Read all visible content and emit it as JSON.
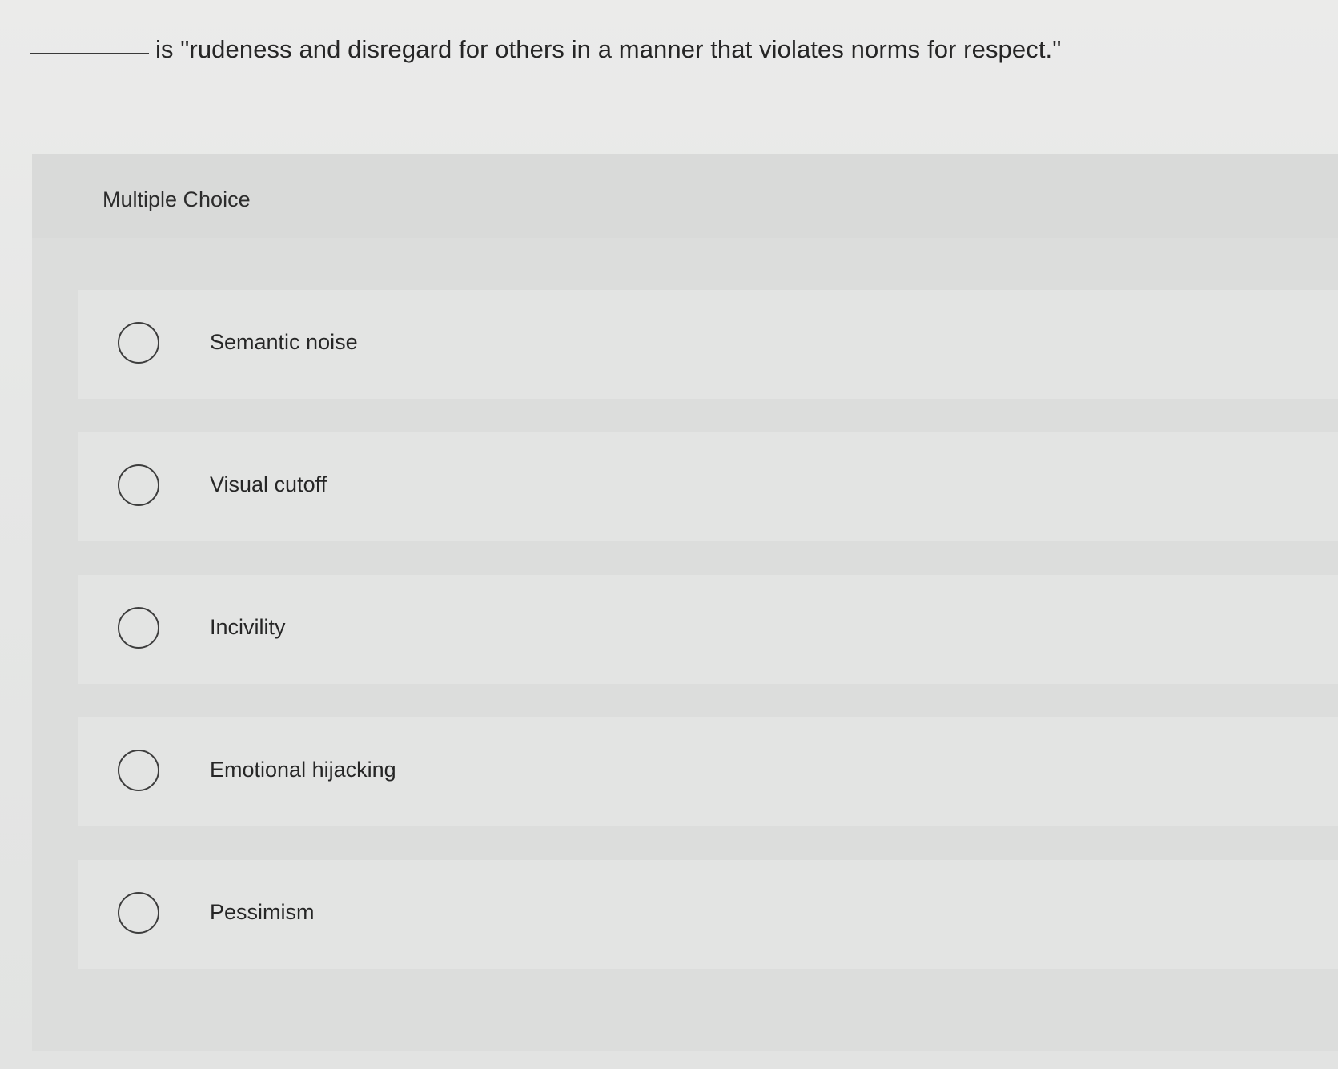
{
  "question": {
    "text": "is \"rudeness and disregard for others in a manner that violates norms for respect.\""
  },
  "section": {
    "label": "Multiple Choice"
  },
  "choices": [
    {
      "label": "Semantic noise"
    },
    {
      "label": "Visual cutoff"
    },
    {
      "label": "Incivility"
    },
    {
      "label": "Emotional hijacking"
    },
    {
      "label": "Pessimism"
    }
  ]
}
